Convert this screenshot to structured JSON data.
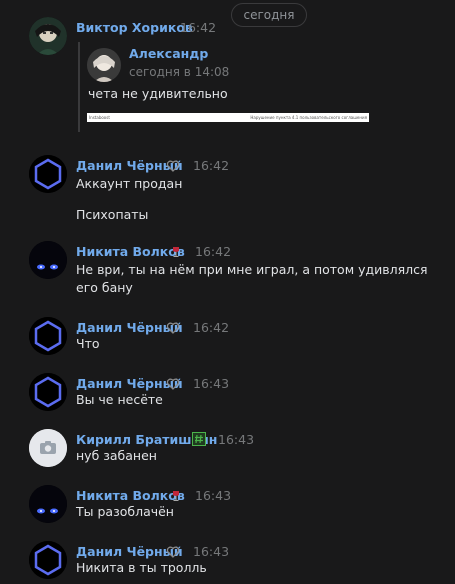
{
  "date_separator": "сегодня",
  "first_message": {
    "author": "Виктор Хориков",
    "time": "16:42",
    "reply": {
      "author": "Александр",
      "time": "сегодня в 14:08",
      "text": "чета не удивительно",
      "image_left_text": "Instaboost",
      "image_right_text": "Нарушение пункта 4.1 пользовательского соглашения"
    }
  },
  "messages": [
    {
      "author": "Данил Чёрный",
      "time": "16:42",
      "lines": [
        "Аккаунт продан",
        "Психопаты"
      ],
      "badge": "heart-icon",
      "avatar": "hexagon"
    },
    {
      "author": "Никита Волков",
      "time": "16:42",
      "lines": [
        "Не ври, ты на нём при мне играл, а потом удивлялся его бану"
      ],
      "badge": "wine-glass-icon",
      "avatar": "eyes"
    },
    {
      "author": "Данил Чёрный",
      "time": "16:42",
      "lines": [
        "Что"
      ],
      "badge": "heart-icon",
      "avatar": "hexagon"
    },
    {
      "author": "Данил Чёрный",
      "time": "16:43",
      "lines": [
        "Вы че несёте"
      ],
      "badge": "heart-icon",
      "avatar": "hexagon"
    },
    {
      "author": "Кирилл Братишкин",
      "time": "16:43",
      "lines": [
        "нуб забанен"
      ],
      "badge": "hash-icon",
      "avatar": "camera"
    },
    {
      "author": "Никита Волков",
      "time": "16:43",
      "lines": [
        "Ты разоблачён"
      ],
      "badge": "wine-glass-icon",
      "avatar": "eyes"
    },
    {
      "author": "Данил Чёрный",
      "time": "16:43",
      "lines": [
        "Никита в ты тролль"
      ],
      "badge": "heart-icon",
      "avatar": "hexagon"
    }
  ],
  "colors": {
    "background": "#19191a",
    "name": "#71aaeb",
    "time": "#76787a",
    "text": "#e1e3e6",
    "accent_green": "#4bb34b"
  }
}
